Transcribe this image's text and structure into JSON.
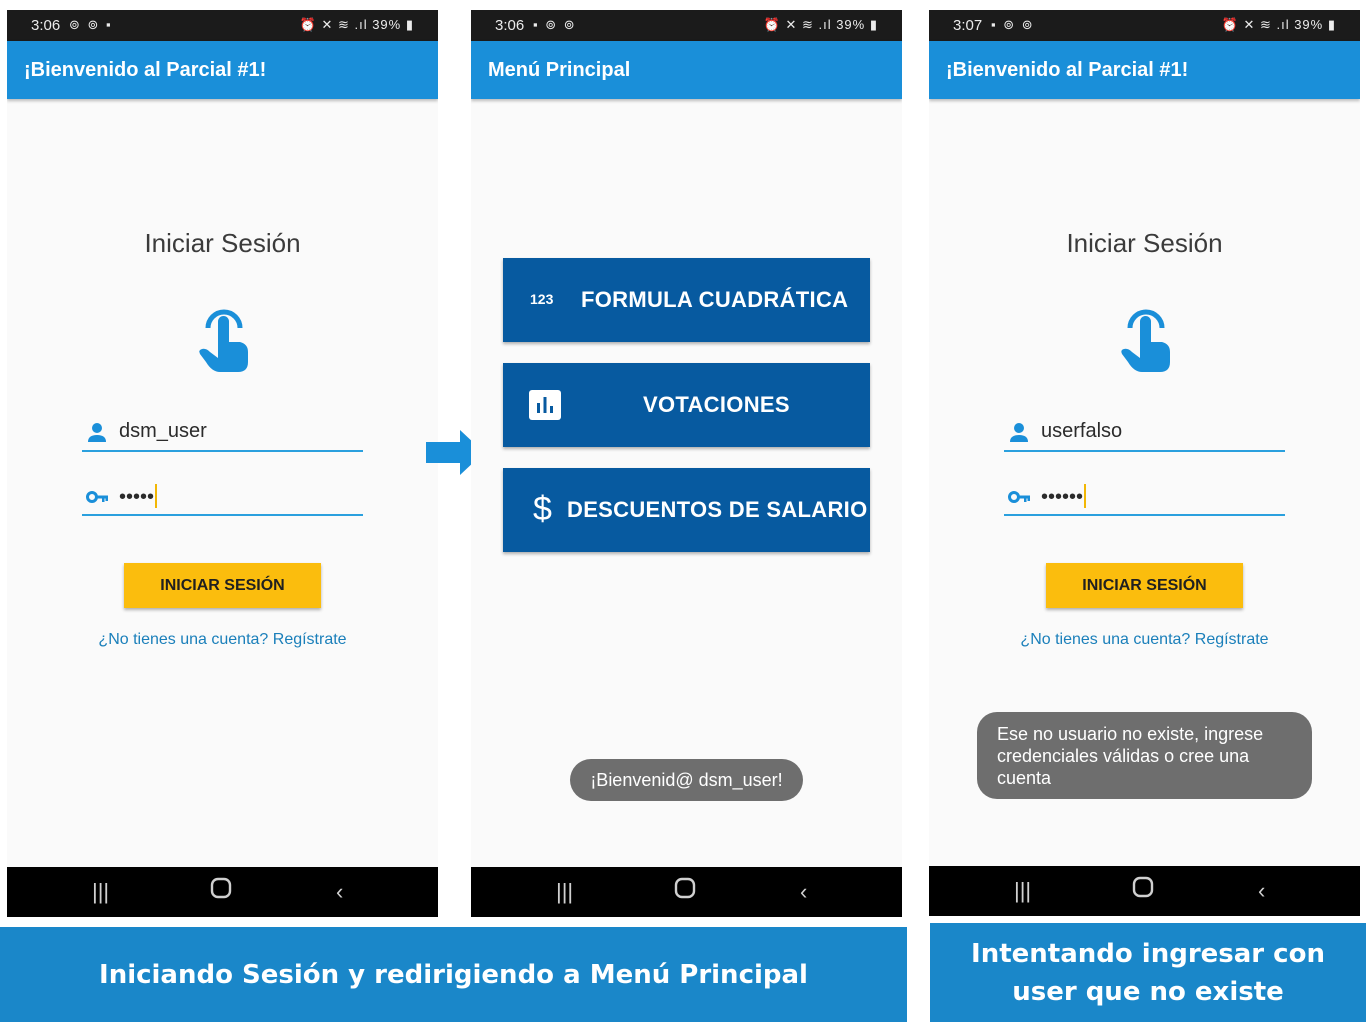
{
  "colors": {
    "appbar": "#1a8fd9",
    "login_button": "#fbbd0d",
    "menu_button": "#075aa0",
    "caption": "#1a87c9",
    "toast": "#6e6e6e"
  },
  "phone_left": {
    "status": {
      "time": "3:06",
      "notif_icons": "⊚ ⊚ ▪",
      "system": "⏰ ✕ ≋ .ıl 39% ▮"
    },
    "appbar_title": "¡Bienvenido al Parcial #1!",
    "heading": "Iniciar Sesión",
    "username_value": "dsm_user",
    "password_value": "•••••",
    "login_button": "INICIAR SESIÓN",
    "register_link": "¿No tienes una cuenta? Regístrate"
  },
  "phone_middle": {
    "status": {
      "time": "3:06",
      "notif_icons": "▪ ⊚ ⊚",
      "system": "⏰ ✕ ≋ .ıl 39% ▮"
    },
    "appbar_title": "Menú Principal",
    "menu": [
      {
        "icon": "numbers-icon",
        "icon_text": "123",
        "label": "FORMULA CUADRÁTICA"
      },
      {
        "icon": "poll-icon",
        "label": "VOTACIONES"
      },
      {
        "icon": "dollar-icon",
        "icon_text": "$",
        "label": "DESCUENTOS DE SALARIO"
      }
    ],
    "toast": "¡Bienvenid@ dsm_user!"
  },
  "phone_right": {
    "status": {
      "time": "3:07",
      "notif_icons": "▪ ⊚ ⊚",
      "system": "⏰ ✕ ≋ .ıl 39% ▮"
    },
    "appbar_title": "¡Bienvenido al Parcial #1!",
    "heading": "Iniciar Sesión",
    "username_value": "userfalso",
    "password_value": "••••••",
    "login_button": "INICIAR SESIÓN",
    "register_link": "¿No tienes una cuenta? Regístrate",
    "toast": "Ese no usuario no existe, ingrese credenciales válidas o cree una cuenta"
  },
  "navbar": {
    "recent": "|||",
    "back": "‹"
  },
  "captions": {
    "left": "Iniciando Sesión y redirigiendo a Menú Principal",
    "right_line1": "Intentando ingresar con",
    "right_line2": "user que no existe"
  }
}
